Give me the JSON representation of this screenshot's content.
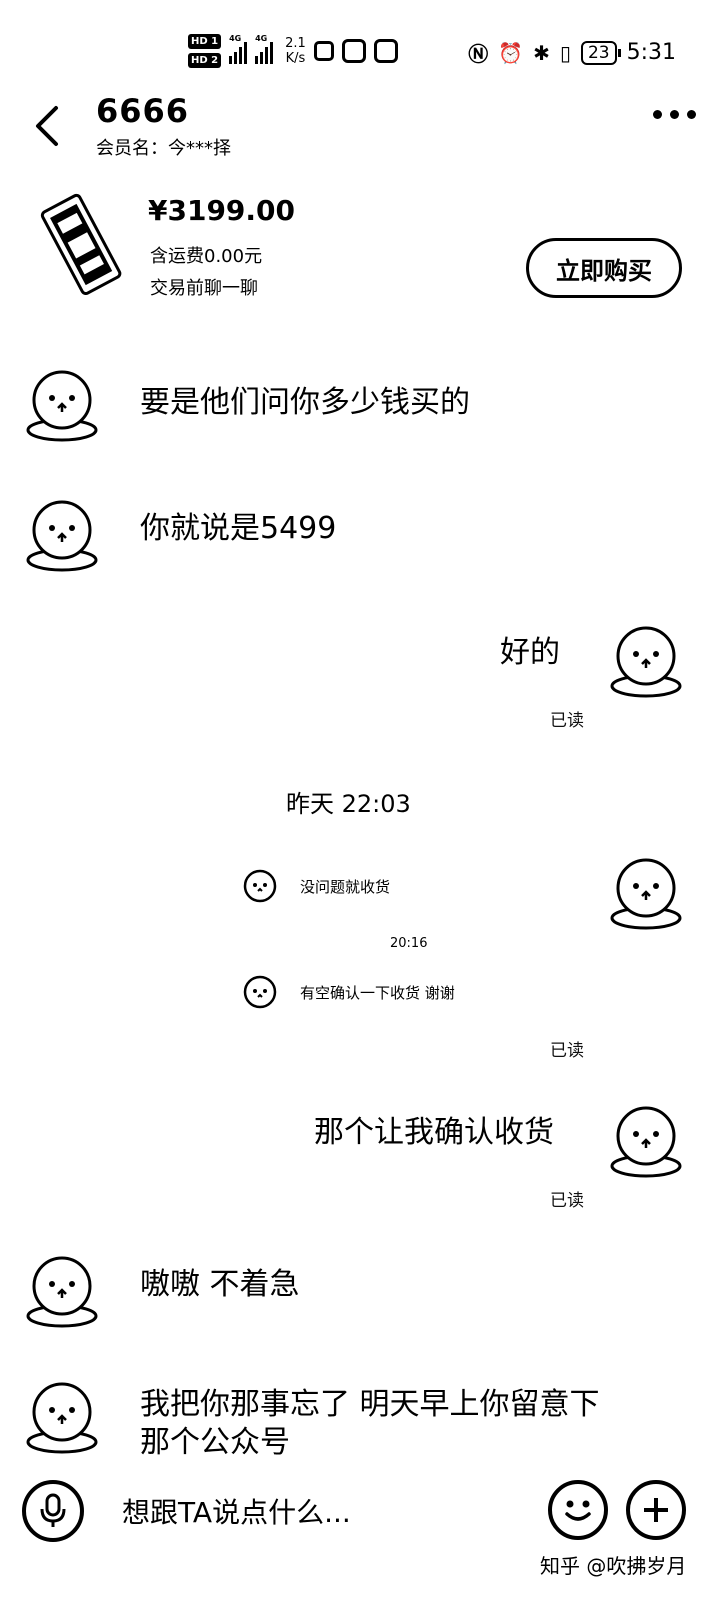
{
  "status_bar": {
    "hd1": "HD 1",
    "hd2": "HD 2",
    "net_type_1": "4G",
    "net_type_2": "4G",
    "net_speed": "2.1\nK/s",
    "battery": "23",
    "time": "5:31"
  },
  "header": {
    "title": "6666",
    "member_name": "会员名：今***择"
  },
  "product": {
    "price": "¥3199.00",
    "shipping": "含运费0.00元",
    "chat_hint": "交易前聊一聊",
    "buy_label": "立即购买"
  },
  "messages": [
    {
      "side": "left",
      "text": "要是他们问你多少钱买的"
    },
    {
      "side": "left",
      "text": "你就说是5499"
    },
    {
      "side": "right",
      "text": "好的",
      "status": "已读"
    },
    {
      "type": "time",
      "text": "昨天 22:03"
    },
    {
      "side": "right",
      "type": "screenshot",
      "line1": "没问题就收货",
      "time": "20:16",
      "line2": "有空确认一下收货 谢谢",
      "status": "已读"
    },
    {
      "side": "right",
      "text": "那个让我确认收货",
      "status": "已读"
    },
    {
      "side": "left",
      "text": "嗷嗷 不着急"
    },
    {
      "side": "left",
      "text": "我把你那事忘了 明天早上你留意下那个公众号"
    }
  ],
  "input": {
    "placeholder": "想跟TA说点什么..."
  },
  "watermark": "知乎 @吹拂岁月"
}
